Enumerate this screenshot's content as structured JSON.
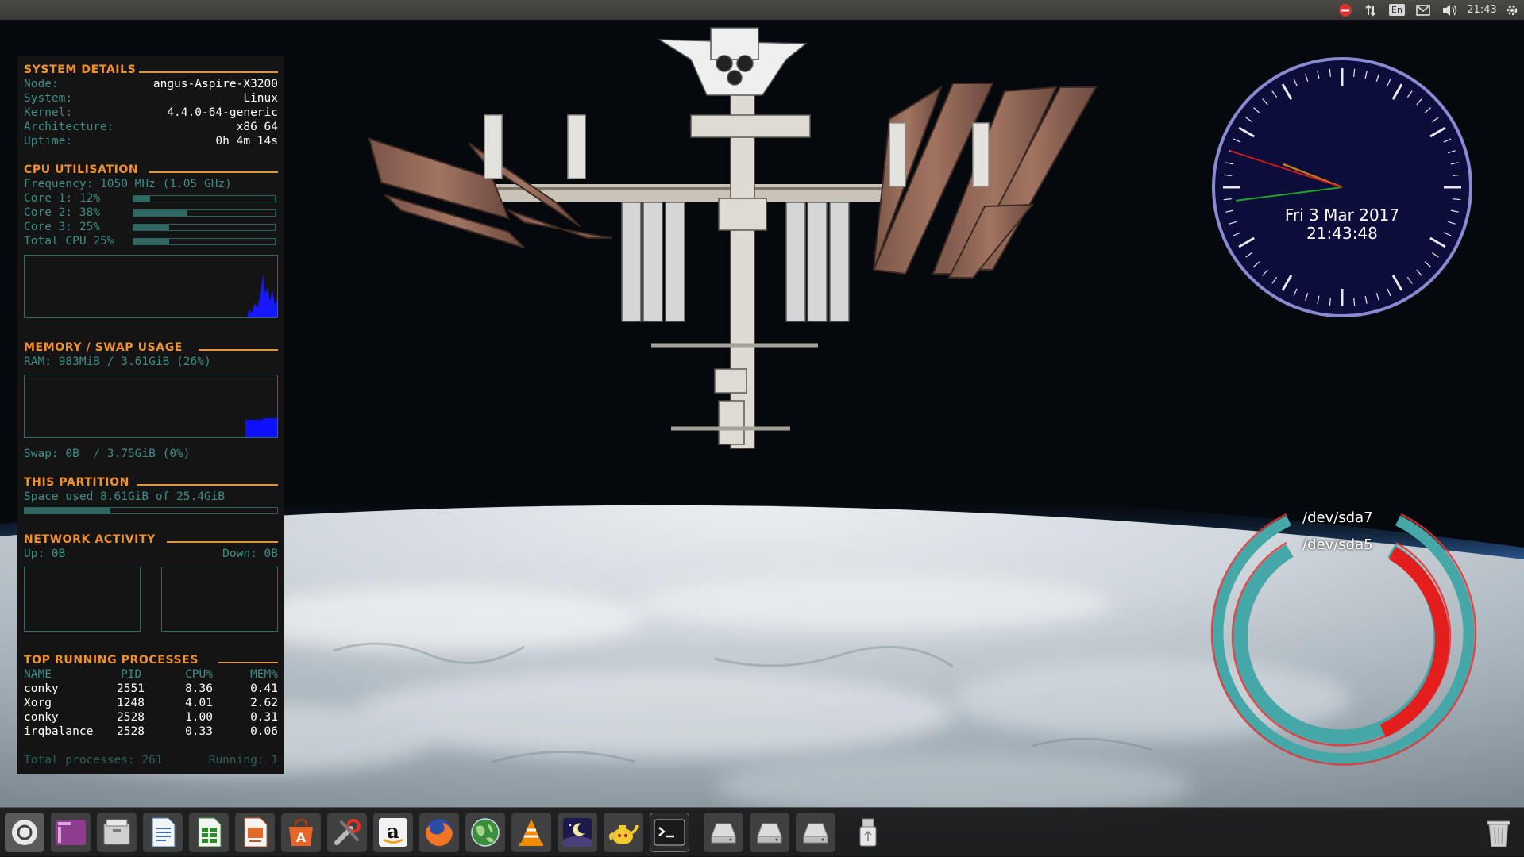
{
  "top_panel": {
    "indicators": [
      "system-status-icon",
      "network-arrows-icon",
      "keyboard-layout-icon",
      "mail-icon",
      "volume-icon"
    ],
    "keyboard_layout": "En",
    "clock": "21:43",
    "session_icon": "gear-icon"
  },
  "conky": {
    "system_details": {
      "heading": "SYSTEM DETAILS",
      "rows": [
        {
          "label": "Node:",
          "value": "angus-Aspire-X3200"
        },
        {
          "label": "System:",
          "value": "Linux"
        },
        {
          "label": "Kernel:",
          "value": "4.4.0-64-generic"
        },
        {
          "label": "Architecture:",
          "value": "x86_64"
        },
        {
          "label": "Uptime:",
          "value": "0h 4m 14s"
        }
      ]
    },
    "cpu": {
      "heading": "CPU UTILISATION",
      "frequency": "Frequency: 1050 MHz (1.05 GHz)",
      "cores": [
        {
          "label": "Core 1: 12%",
          "percent": 12
        },
        {
          "label": "Core 2: 38%",
          "percent": 38
        },
        {
          "label": "Core 3: 25%",
          "percent": 25
        },
        {
          "label": "Total CPU 25%",
          "percent": 25
        }
      ]
    },
    "memory": {
      "heading": "MEMORY / SWAP USAGE",
      "ram": "RAM: 983MiB / 3.61GiB (26%)",
      "swap": "Swap: 0B  / 3.75GiB (0%)"
    },
    "partition": {
      "heading": "THIS PARTITION",
      "space": "Space used 8.61GiB of 25.4GiB",
      "percent": 34
    },
    "network": {
      "heading": "NETWORK ACTIVITY",
      "up": "Up: 0B",
      "down": "Down: 0B"
    },
    "processes": {
      "heading": "TOP RUNNING PROCESSES",
      "columns": [
        "NAME",
        "PID",
        "CPU%",
        "MEM%"
      ],
      "rows": [
        {
          "name": "conky",
          "pid": "2551",
          "cpu": "8.36",
          "mem": "0.41"
        },
        {
          "name": "Xorg",
          "pid": "1248",
          "cpu": "4.01",
          "mem": "2.62"
        },
        {
          "name": "conky",
          "pid": "2528",
          "cpu": "1.00",
          "mem": "0.31"
        },
        {
          "name": "irqbalance",
          "pid": "2528",
          "cpu": "0.33",
          "mem": "0.06"
        }
      ],
      "total": "Total processes: 261",
      "running": "Running: 1"
    }
  },
  "clock_widget": {
    "date": "Fri  3 Mar 2017",
    "time": "21:43:48",
    "hours": 21,
    "minutes": 43,
    "seconds": 48
  },
  "disk_rings": [
    {
      "label": "/dev/sda7"
    },
    {
      "label": "/dev/sda5",
      "used_fraction": 0.35
    }
  ],
  "dock": {
    "items": [
      "dash-icon",
      "workspace-switcher-icon",
      "file-manager-icon",
      "writer-icon",
      "calc-icon",
      "impress-icon",
      "software-center-icon",
      "system-settings-icon",
      "amazon-icon",
      "firefox-icon",
      "earth-globe-icon",
      "vlc-icon",
      "stellarium-icon",
      "teapot-icon",
      "terminal-icon",
      "drive-icon",
      "drive-icon",
      "drive-icon",
      "usb-drive-icon"
    ],
    "trash": "trash-icon"
  },
  "colors": {
    "conky_heading": "#f09030",
    "conky_label": "#3e8d86",
    "conky_value": "#ffffff",
    "graph_fill": "#0000ff",
    "clock_face": "#0c0d3a",
    "clock_rim": "#8a8ad0",
    "ring_teal": "#45a7a7",
    "ring_red": "#e41d1d"
  }
}
